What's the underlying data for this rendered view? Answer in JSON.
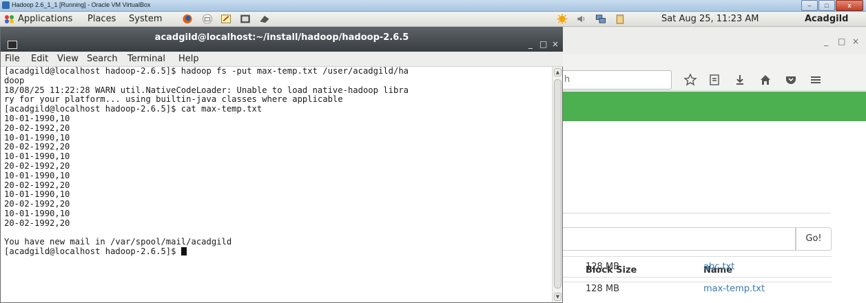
{
  "host_window": {
    "title": "Hadoop 2.6_1_1 [Running] - Oracle VM VirtualBox",
    "controls": {
      "minimize": "–",
      "maximize": "□",
      "close": "x"
    }
  },
  "gnome_panel": {
    "menus": [
      "Applications",
      "Places",
      "System"
    ],
    "clock": "Sat Aug 25, 11:23 AM",
    "user": "Acadgild"
  },
  "terminal": {
    "title": "acadgild@localhost:~/install/hadoop/hadoop-2.6.5",
    "controls": {
      "minimize": "_",
      "maximize": "□",
      "close": "×"
    },
    "menu": [
      "File",
      "Edit",
      "View",
      "Search",
      "Terminal",
      "Help"
    ],
    "lines": [
      "[acadgild@localhost hadoop-2.6.5]$ hadoop fs -put max-temp.txt /user/acadgild/ha",
      "doop",
      "18/08/25 11:22:28 WARN util.NativeCodeLoader: Unable to load native-hadoop libra",
      "ry for your platform... using builtin-java classes where applicable",
      "[acadgild@localhost hadoop-2.6.5]$ cat max-temp.txt",
      "10-01-1990,10",
      "20-02-1992,20",
      "10-01-1990,10",
      "20-02-1992,20",
      "10-01-1990,10",
      "20-02-1992,20",
      "10-01-1990,10",
      "20-02-1992,20",
      "10-01-1990,10",
      "20-02-1992,20",
      "10-01-1990,10",
      "20-02-1992,20",
      "",
      "You have new mail in /var/spool/mail/acadgild"
    ],
    "prompt": "[acadgild@localhost hadoop-2.6.5]$ "
  },
  "browser": {
    "window_controls": {
      "minimize": "_",
      "maximize": "□",
      "close": "×"
    },
    "search_partial": "h",
    "go_button": "Go!",
    "table": {
      "headers": [
        "Block Size",
        "Name"
      ],
      "rows": [
        {
          "block_size": "128 MB",
          "name": "abc.txt"
        },
        {
          "block_size": "128 MB",
          "name": "max-temp.txt"
        }
      ]
    }
  },
  "colors": {
    "banner_green": "#4caf50",
    "link_blue": "#337ab7",
    "terminal_titlebar": "#45494d"
  }
}
